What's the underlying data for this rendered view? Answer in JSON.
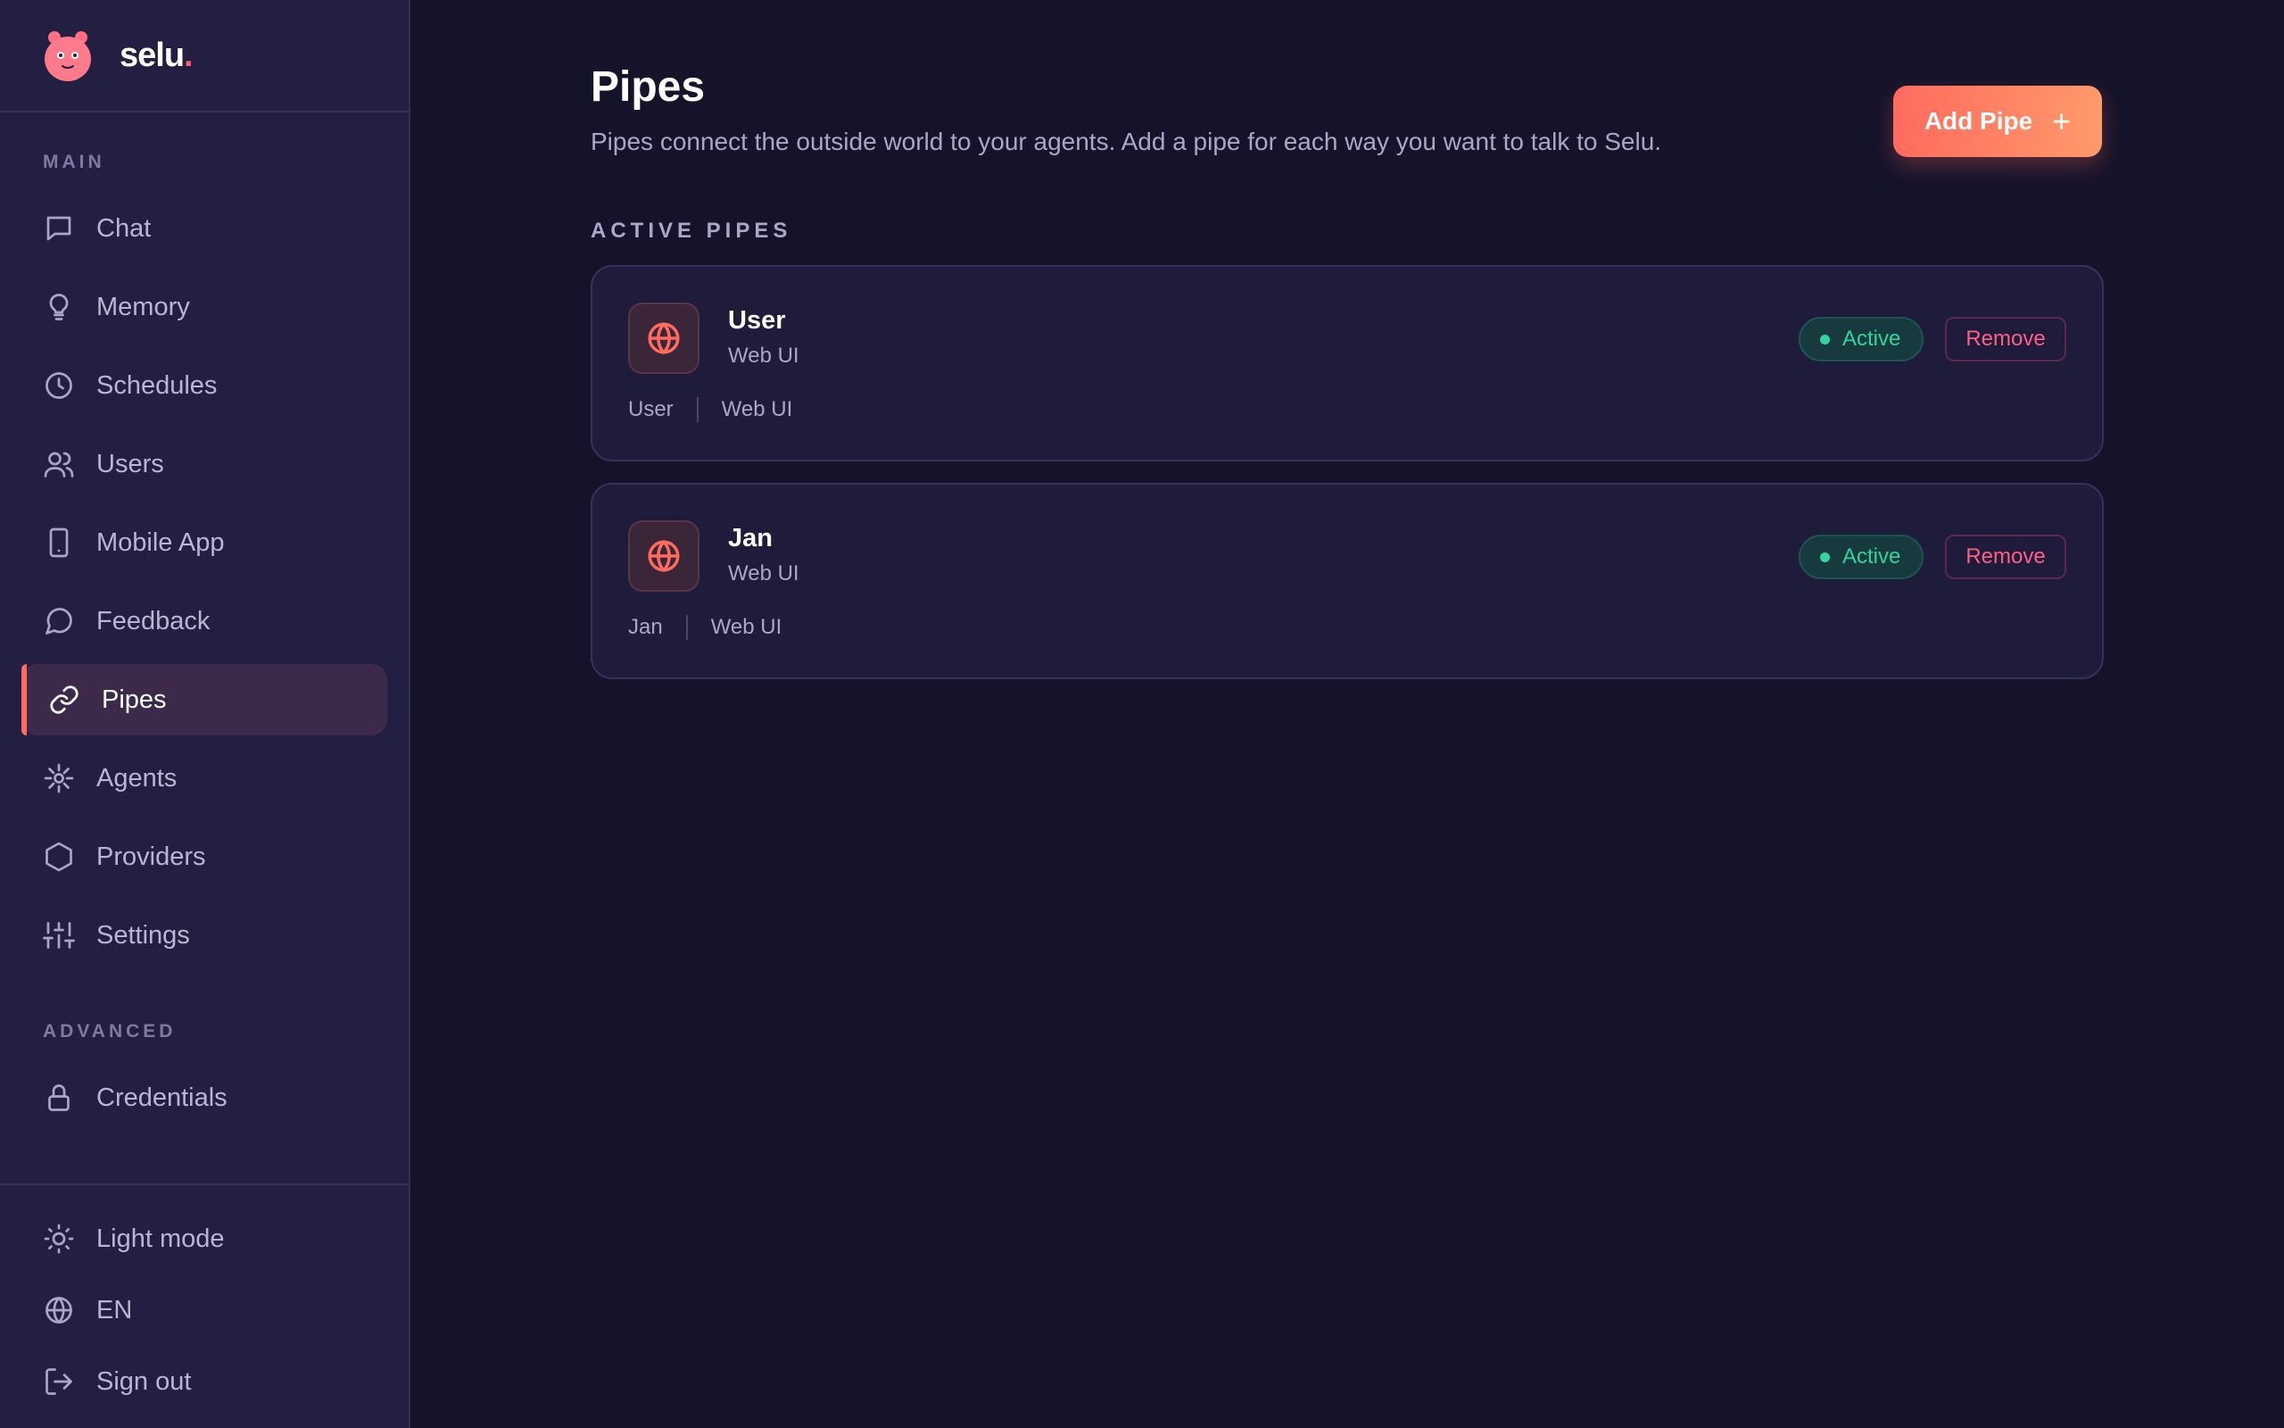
{
  "brand": {
    "name": "selu",
    "dot": "."
  },
  "sidebar": {
    "main_label": "MAIN",
    "items": [
      {
        "label": "Chat",
        "icon": "chat-icon"
      },
      {
        "label": "Memory",
        "icon": "lightbulb-icon"
      },
      {
        "label": "Schedules",
        "icon": "clock-icon"
      },
      {
        "label": "Users",
        "icon": "users-icon"
      },
      {
        "label": "Mobile App",
        "icon": "mobile-icon"
      },
      {
        "label": "Feedback",
        "icon": "speech-bubble-icon"
      },
      {
        "label": "Pipes",
        "icon": "link-icon",
        "active": true
      },
      {
        "label": "Agents",
        "icon": "agent-icon"
      },
      {
        "label": "Providers",
        "icon": "hexagon-icon"
      },
      {
        "label": "Settings",
        "icon": "sliders-icon"
      }
    ],
    "advanced_label": "ADVANCED",
    "advanced_items": [
      {
        "label": "Credentials",
        "icon": "lock-icon"
      }
    ],
    "bottom": {
      "theme": "Light mode",
      "language": "EN",
      "signout": "Sign out"
    }
  },
  "page": {
    "title": "Pipes",
    "description": "Pipes connect the outside world to your agents. Add a pipe for each way you want to talk to Selu.",
    "add_button": "Add Pipe",
    "add_button_plus": "+",
    "section_heading": "ACTIVE PIPES"
  },
  "pipes": [
    {
      "name": "User",
      "type": "Web UI",
      "meta_name": "User",
      "meta_type": "Web UI",
      "status": "Active",
      "remove": "Remove"
    },
    {
      "name": "Jan",
      "type": "Web UI",
      "meta_name": "Jan",
      "meta_type": "Web UI",
      "status": "Active",
      "remove": "Remove"
    }
  ],
  "colors": {
    "accent": "#ff6b5e",
    "active_status": "#34d4a0",
    "remove": "#ff5f86",
    "background": "#15132a",
    "sidebar": "#231f42"
  }
}
